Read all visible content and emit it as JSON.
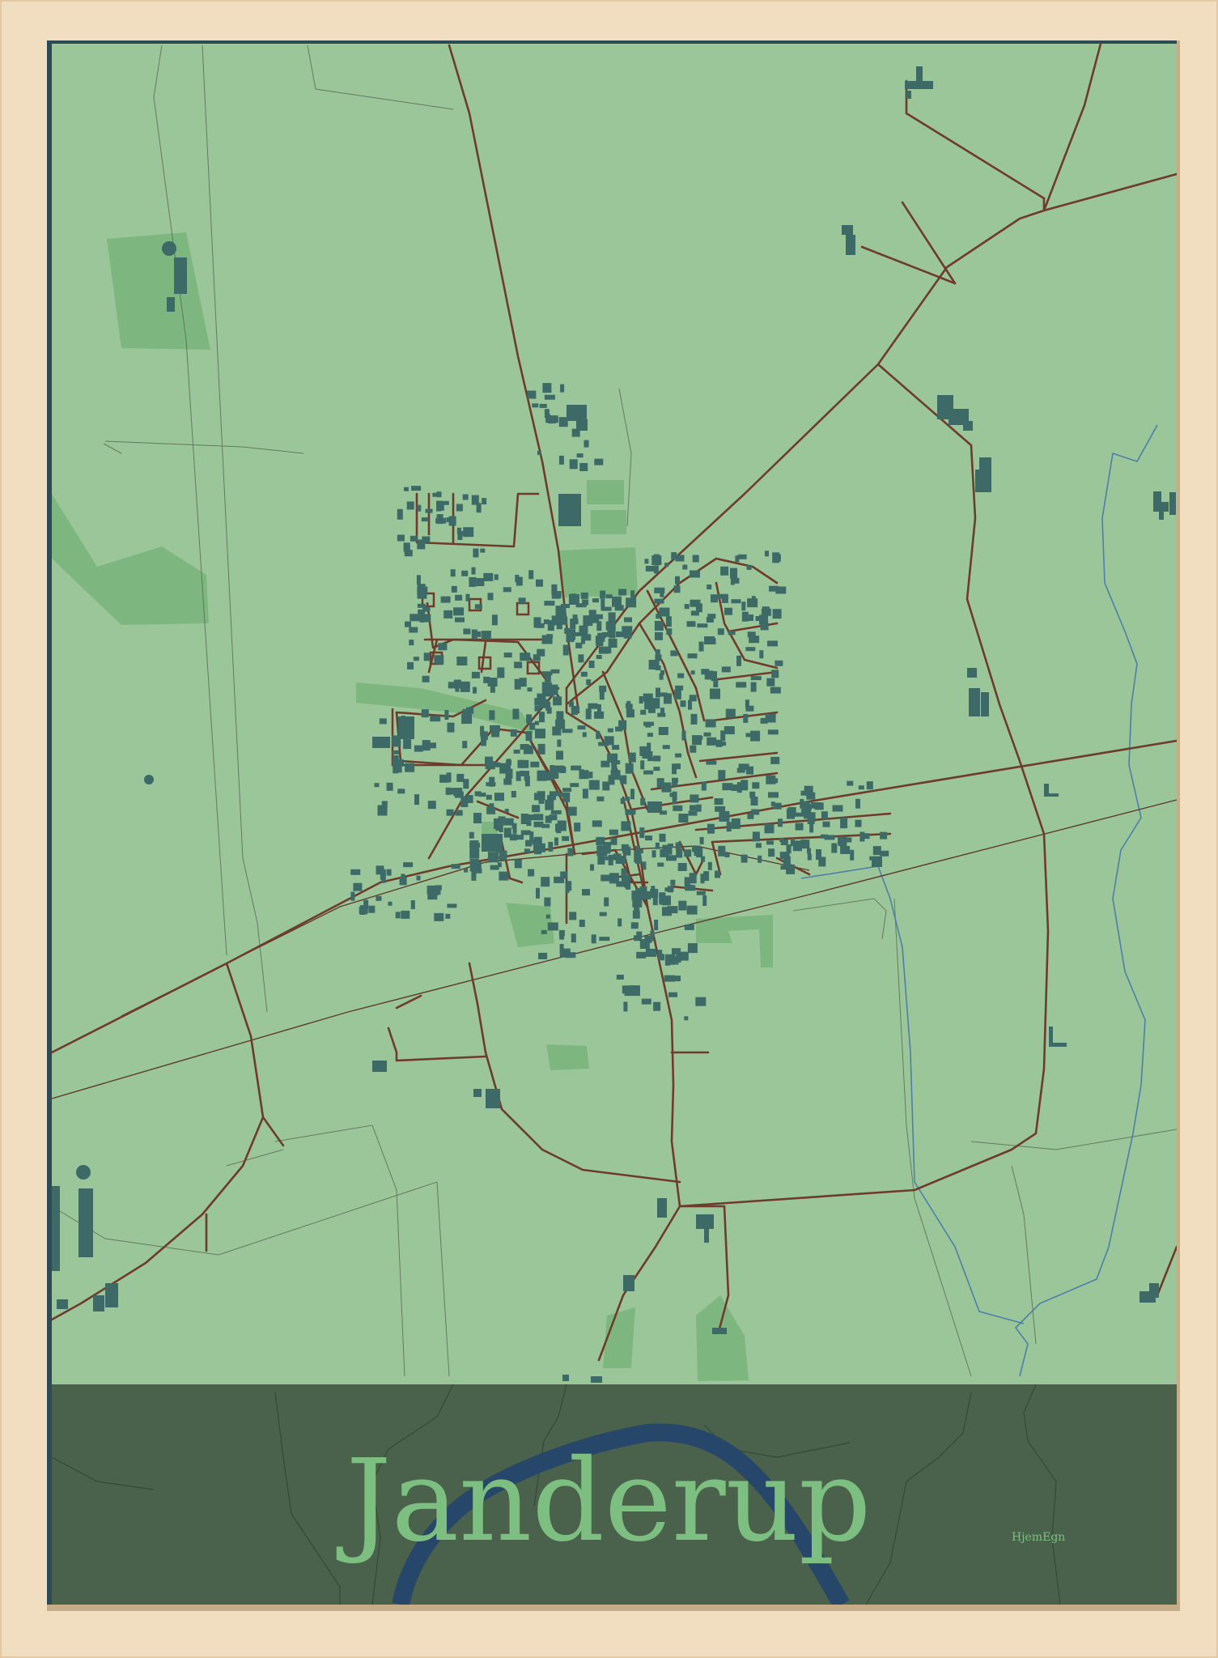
{
  "poster": {
    "title": "Janderup",
    "signature": "HjemEgn"
  },
  "colors": {
    "frame": "#f1ddbf",
    "map_background": "#9ac69a",
    "field_patch": "#7db77f",
    "building": "#3d6a66",
    "road": "#6e3b2d",
    "railway": "#5c3a2f",
    "stream": "#4e7fa8",
    "band": "#4a614b",
    "title": "#7cbf80",
    "river": "#26466a"
  },
  "icons": {
    "frame": "wood-frame",
    "map": "street-map"
  }
}
